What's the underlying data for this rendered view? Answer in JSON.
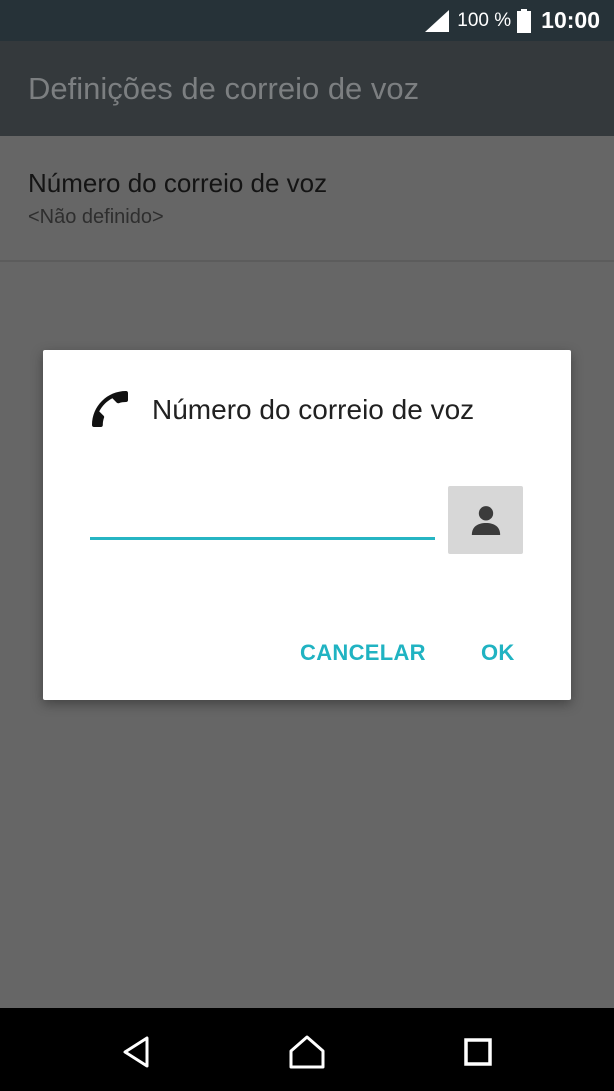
{
  "status_bar": {
    "battery_percent": "100 %",
    "time": "10:00",
    "signal_icon": "signal-icon",
    "battery_icon": "battery-full-icon"
  },
  "app_bar": {
    "title": "Definições de correio de voz"
  },
  "settings": {
    "voicemail_number": {
      "title": "Número do correio de voz",
      "summary": "<Não definido>"
    }
  },
  "dialog": {
    "icon": "phone-icon",
    "title": "Número do correio de voz",
    "input_value": "",
    "contact_icon": "contact-person-icon",
    "cancel_label": "CANCELAR",
    "ok_label": "OK"
  },
  "nav_bar": {
    "icons": [
      "back-icon",
      "home-icon",
      "recents-icon"
    ]
  },
  "colors": {
    "accent": "#20b3c2",
    "status_bar": "#263238",
    "app_bar": "#34393c",
    "scrim_background": "#666666"
  }
}
